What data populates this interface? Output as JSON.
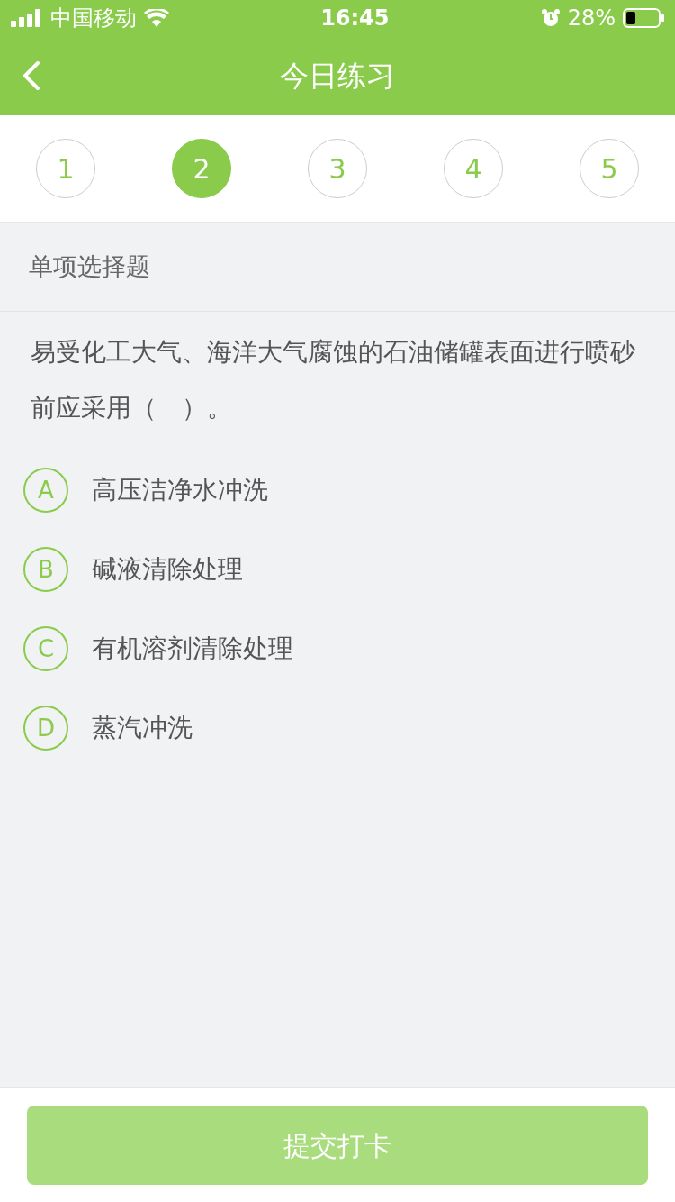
{
  "status_bar": {
    "carrier": "中国移动",
    "time": "16:45",
    "battery": "28%"
  },
  "nav": {
    "title": "今日练习"
  },
  "steps": [
    {
      "label": "1",
      "selected": false
    },
    {
      "label": "2",
      "selected": true
    },
    {
      "label": "3",
      "selected": false
    },
    {
      "label": "4",
      "selected": false
    },
    {
      "label": "5",
      "selected": false
    }
  ],
  "section": "单项选择题",
  "question": "易受化工大气、海洋大气腐蚀的石油储罐表面进行喷砂前应采用（　）。",
  "options": [
    {
      "letter": "A",
      "text": "高压洁净水冲洗",
      "selected": false
    },
    {
      "letter": "B",
      "text": "碱液清除处理",
      "selected": false
    },
    {
      "letter": "C",
      "text": "有机溶剂清除处理",
      "selected": false
    },
    {
      "letter": "D",
      "text": "蒸汽冲洗",
      "selected": false
    }
  ],
  "submit": {
    "label": "提交打卡",
    "disabled": true
  }
}
